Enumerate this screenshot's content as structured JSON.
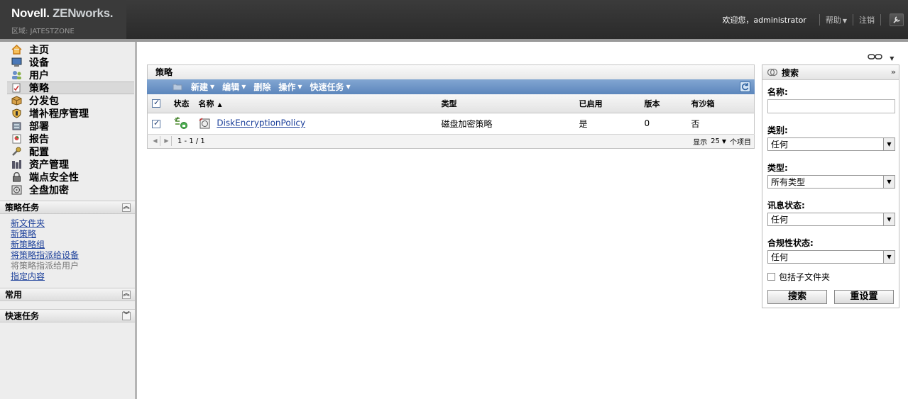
{
  "header": {
    "brand_novell": "Novell.",
    "brand_zen": "ZENworks.",
    "zone": "区域: JATESTZONE",
    "welcome": "欢迎您，administrator",
    "help": "帮助",
    "logout": "注销"
  },
  "nav": {
    "items": [
      {
        "label": "主页",
        "icon": "home-icon"
      },
      {
        "label": "设备",
        "icon": "device-icon"
      },
      {
        "label": "用户",
        "icon": "users-icon"
      },
      {
        "label": "策略",
        "icon": "policy-icon"
      },
      {
        "label": "分发包",
        "icon": "bundle-icon"
      },
      {
        "label": "增补程序管理",
        "icon": "patch-icon"
      },
      {
        "label": "部署",
        "icon": "deploy-icon"
      },
      {
        "label": "报告",
        "icon": "report-icon"
      },
      {
        "label": "配置",
        "icon": "config-icon"
      },
      {
        "label": "资产管理",
        "icon": "asset-icon"
      },
      {
        "label": "端点安全性",
        "icon": "lock-icon"
      },
      {
        "label": "全盘加密",
        "icon": "disk-encryption-icon"
      }
    ],
    "active_index": 3
  },
  "policy_tasks": {
    "title": "策略任务",
    "links": [
      {
        "label": "新文件夹",
        "enabled": true
      },
      {
        "label": "新策略",
        "enabled": true
      },
      {
        "label": "新策略组",
        "enabled": true
      },
      {
        "label": "将策略指派给设备",
        "enabled": true
      },
      {
        "label": "将策略指派给用户",
        "enabled": false
      },
      {
        "label": "指定内容",
        "enabled": true
      }
    ]
  },
  "common": {
    "title": "常用"
  },
  "quick_tasks": {
    "title": "快速任务"
  },
  "panel": {
    "title": "策略",
    "toolbar": {
      "new": "新建",
      "edit": "编辑",
      "delete": "删除",
      "action": "操作",
      "quick": "快速任务"
    },
    "columns": {
      "status": "状态",
      "name": "名称",
      "type": "类型",
      "enabled": "已启用",
      "version": "版本",
      "sandbox": "有沙箱"
    },
    "rows": [
      {
        "name": "DiskEncryptionPolicy",
        "type": "磁盘加密策略",
        "enabled": "是",
        "version": "0",
        "sandbox": "否"
      }
    ],
    "pager": {
      "range": "1 - 1 / 1",
      "show": "显示",
      "page_size": "25",
      "items": "个项目"
    }
  },
  "search": {
    "title": "搜索",
    "name_label": "名称:",
    "category_label": "类别:",
    "category_value": "任何",
    "type_label": "类型:",
    "type_value": "所有类型",
    "message_label": "讯息状态:",
    "message_value": "任何",
    "compliance_label": "合规性状态:",
    "compliance_value": "任何",
    "subfolder_label": "包括子文件夹",
    "search_button": "搜索",
    "reset_button": "重设置"
  }
}
